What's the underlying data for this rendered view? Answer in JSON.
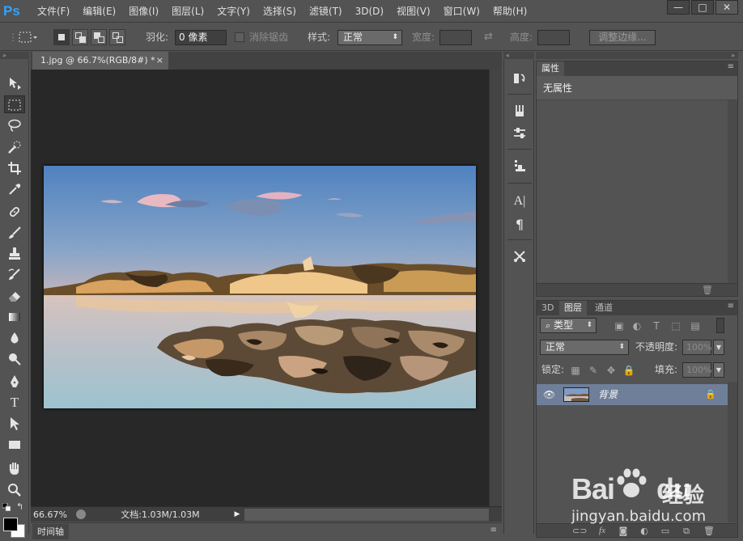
{
  "app": {
    "logo": "Ps"
  },
  "menu": [
    "文件(F)",
    "编辑(E)",
    "图像(I)",
    "图层(L)",
    "文字(Y)",
    "选择(S)",
    "滤镜(T)",
    "3D(D)",
    "视图(V)",
    "窗口(W)",
    "帮助(H)"
  ],
  "window_controls": {
    "minimize": "—",
    "maximize": "□",
    "close": "✕"
  },
  "options": {
    "feather_label": "羽化:",
    "feather_value": "0 像素",
    "antialias_label": "消除锯齿",
    "style_label": "样式:",
    "style_value": "正常",
    "width_label": "宽度:",
    "height_label": "高度:",
    "refine_edge_button": "调整边缘..."
  },
  "document": {
    "tab_title": "1.jpg @ 66.7%(RGB/8#) *",
    "tab_close": "×"
  },
  "status": {
    "zoom": "66.67%",
    "doc_info": "文档:1.03M/1.03M"
  },
  "timeline": {
    "tab": "时间轴"
  },
  "properties_panel": {
    "tab": "属性",
    "no_properties": "无属性"
  },
  "layers_panel": {
    "tabs": [
      "3D",
      "图层",
      "通道"
    ],
    "filter_kind": "类型",
    "blend_mode": "正常",
    "opacity_label": "不透明度:",
    "opacity_value": "100%",
    "lock_label": "锁定:",
    "fill_label": "填充:",
    "fill_value": "100%",
    "layer_name": "背景"
  },
  "watermark": {
    "brand": "Bai du",
    "brand_left": "Bai",
    "brand_right": "du",
    "site": "经验",
    "url": "jingyan.baidu.com"
  },
  "colors": {
    "ui_bg": "#535353",
    "canvas_bg": "#282828",
    "selected_layer": "#6f7f99",
    "ps_blue": "#2fa3ff"
  }
}
